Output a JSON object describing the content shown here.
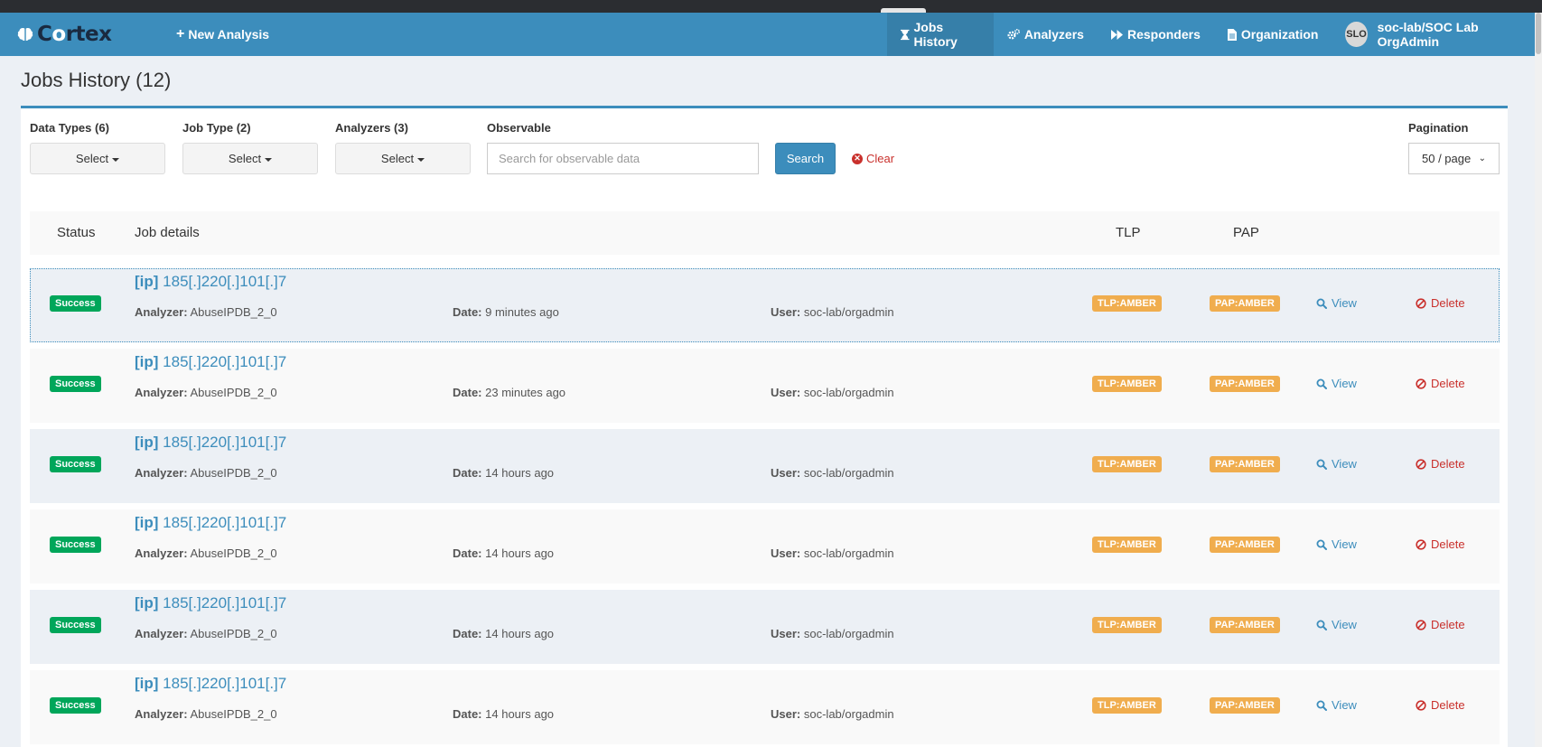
{
  "brand": {
    "name_prefix": "C",
    "name_o": "o",
    "name_suffix": "rtex"
  },
  "nav": {
    "new_analysis": "New Analysis",
    "items": [
      {
        "label": "Jobs History",
        "icon": "hourglass-icon",
        "active": true
      },
      {
        "label": "Analyzers",
        "icon": "gears-icon"
      },
      {
        "label": "Responders",
        "icon": "fast-forward-icon"
      },
      {
        "label": "Organization",
        "icon": "file-icon"
      }
    ],
    "user": {
      "initials": "SLO",
      "label": "soc-lab/SOC Lab OrgAdmin"
    }
  },
  "page": {
    "title": "Jobs History (12)"
  },
  "filters": {
    "data_types_label": "Data Types (6)",
    "job_type_label": "Job Type (2)",
    "analyzers_label": "Analyzers (3)",
    "observable_label": "Observable",
    "select_text": "Select",
    "observable_placeholder": "Search for observable data",
    "search_button": "Search",
    "clear_button": "Clear",
    "pagination_label": "Pagination",
    "pagination_value": "50 / page"
  },
  "table": {
    "headers": {
      "status": "Status",
      "details": "Job details",
      "tlp": "TLP",
      "pap": "PAP"
    },
    "labels": {
      "analyzer": "Analyzer:",
      "date": "Date:",
      "user": "User:",
      "view": "View",
      "delete": "Delete"
    },
    "rows": [
      {
        "status": "Success",
        "type": "[ip]",
        "observable": "185[.]220[.]101[.]7",
        "analyzer": "AbuseIPDB_2_0",
        "date": "9 minutes ago",
        "user": "soc-lab/orgadmin",
        "tlp": "TLP:AMBER",
        "pap": "PAP:AMBER"
      },
      {
        "status": "Success",
        "type": "[ip]",
        "observable": "185[.]220[.]101[.]7",
        "analyzer": "AbuseIPDB_2_0",
        "date": "23 minutes ago",
        "user": "soc-lab/orgadmin",
        "tlp": "TLP:AMBER",
        "pap": "PAP:AMBER"
      },
      {
        "status": "Success",
        "type": "[ip]",
        "observable": "185[.]220[.]101[.]7",
        "analyzer": "AbuseIPDB_2_0",
        "date": "14 hours ago",
        "user": "soc-lab/orgadmin",
        "tlp": "TLP:AMBER",
        "pap": "PAP:AMBER"
      },
      {
        "status": "Success",
        "type": "[ip]",
        "observable": "185[.]220[.]101[.]7",
        "analyzer": "AbuseIPDB_2_0",
        "date": "14 hours ago",
        "user": "soc-lab/orgadmin",
        "tlp": "TLP:AMBER",
        "pap": "PAP:AMBER"
      },
      {
        "status": "Success",
        "type": "[ip]",
        "observable": "185[.]220[.]101[.]7",
        "analyzer": "AbuseIPDB_2_0",
        "date": "14 hours ago",
        "user": "soc-lab/orgadmin",
        "tlp": "TLP:AMBER",
        "pap": "PAP:AMBER"
      },
      {
        "status": "Success",
        "type": "[ip]",
        "observable": "185[.]220[.]101[.]7",
        "analyzer": "AbuseIPDB_2_0",
        "date": "14 hours ago",
        "user": "soc-lab/orgadmin",
        "tlp": "TLP:AMBER",
        "pap": "PAP:AMBER"
      }
    ]
  },
  "colors": {
    "navbar": "#3c8dbc",
    "success": "#00a65a",
    "amber": "#f0ad4e",
    "danger": "#c9302c"
  }
}
